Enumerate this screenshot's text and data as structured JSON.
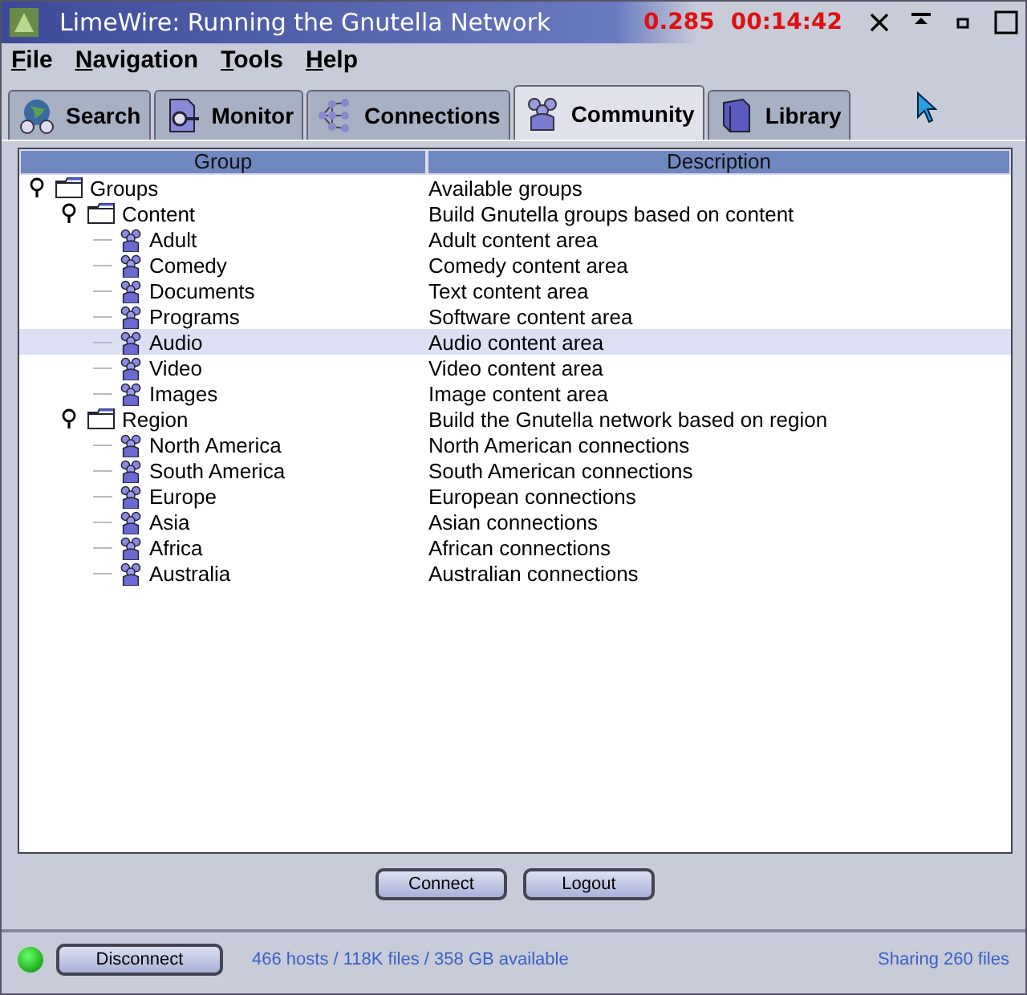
{
  "window": {
    "title": "LimeWire: Running the Gnutella Network",
    "stats": [
      "0.285",
      "00:14:42"
    ]
  },
  "menu": [
    "File",
    "Navigation",
    "Tools",
    "Help"
  ],
  "tabs": [
    {
      "label": "Search",
      "selected": false
    },
    {
      "label": "Monitor",
      "selected": false
    },
    {
      "label": "Connections",
      "selected": false
    },
    {
      "label": "Community",
      "selected": true
    },
    {
      "label": "Library",
      "selected": false
    }
  ],
  "table": {
    "columns": [
      "Group",
      "Description"
    ],
    "tree": [
      {
        "kind": "folder",
        "label": "Groups",
        "description": "Available groups",
        "expanded": true,
        "selected": false,
        "children": [
          {
            "kind": "folder",
            "label": "Content",
            "description": "Build Gnutella groups based on content",
            "expanded": true,
            "selected": false,
            "children": [
              {
                "kind": "group",
                "label": "Adult",
                "description": "Adult content area",
                "selected": false
              },
              {
                "kind": "group",
                "label": "Comedy",
                "description": "Comedy content area",
                "selected": false
              },
              {
                "kind": "group",
                "label": "Documents",
                "description": "Text content area",
                "selected": false
              },
              {
                "kind": "group",
                "label": "Programs",
                "description": "Software content area",
                "selected": false
              },
              {
                "kind": "group",
                "label": "Audio",
                "description": "Audio content area",
                "selected": true
              },
              {
                "kind": "group",
                "label": "Video",
                "description": "Video content area",
                "selected": false
              },
              {
                "kind": "group",
                "label": "Images",
                "description": "Image content area",
                "selected": false
              }
            ]
          },
          {
            "kind": "folder",
            "label": "Region",
            "description": "Build the Gnutella network based on region",
            "expanded": true,
            "selected": false,
            "children": [
              {
                "kind": "group",
                "label": "North America",
                "description": "North American connections",
                "selected": false
              },
              {
                "kind": "group",
                "label": "South America",
                "description": "South American connections",
                "selected": false
              },
              {
                "kind": "group",
                "label": "Europe",
                "description": "European connections",
                "selected": false
              },
              {
                "kind": "group",
                "label": "Asia",
                "description": "Asian connections",
                "selected": false
              },
              {
                "kind": "group",
                "label": "Africa",
                "description": "African connections",
                "selected": false
              },
              {
                "kind": "group",
                "label": "Australia",
                "description": "Australian connections",
                "selected": false
              }
            ]
          }
        ]
      }
    ]
  },
  "buttons": [
    "Connect",
    "Logout"
  ],
  "status_bar": {
    "connected": true,
    "button": "Disconnect",
    "hosts": "466 hosts / 118K files / 358 GB available",
    "sharing": "Sharing 260 files"
  }
}
